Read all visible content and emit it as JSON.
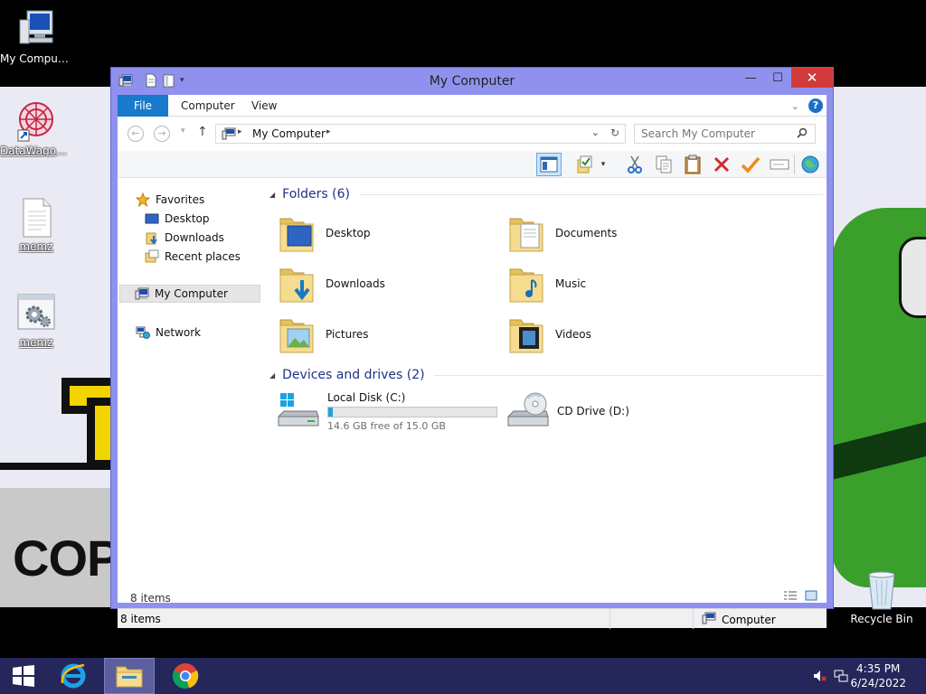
{
  "desktop": {
    "icons": [
      {
        "label": "My Computer"
      },
      {
        "label": "DataWagon..."
      },
      {
        "label": "memz"
      },
      {
        "label": "memz"
      },
      {
        "label": "Recycle Bin"
      }
    ],
    "wallpaper_text": "COP"
  },
  "window": {
    "title": "My Computer",
    "controls": {
      "minimize": "—",
      "maximize": "☐",
      "close": "✕"
    },
    "ribbon": {
      "tabs": [
        "File",
        "Computer",
        "View"
      ],
      "help": "?"
    },
    "address": {
      "path": "My Computer",
      "search_placeholder": "Search My Computer"
    },
    "nav_pane": {
      "favorites": "Favorites",
      "favorite_items": [
        "Desktop",
        "Downloads",
        "Recent places"
      ],
      "computer": "My Computer",
      "network": "Network"
    },
    "content": {
      "folders_header": "Folders (6)",
      "folders": [
        "Desktop",
        "Documents",
        "Downloads",
        "Music",
        "Pictures",
        "Videos"
      ],
      "devices_header": "Devices and drives (2)",
      "drives": [
        {
          "name": "Local Disk (C:)",
          "free_text": "14.6 GB free of 15.0 GB",
          "used_fraction": 0.027
        },
        {
          "name": "CD Drive (D:)"
        }
      ],
      "item_count": "8 items"
    },
    "statusbar": {
      "items": "8 items",
      "location": "Computer"
    }
  },
  "taskbar": {
    "time": "4:35 PM",
    "date": "6/24/2022"
  },
  "colors": {
    "window_frame": "#8e92ee",
    "ribbon_file_tab": "#1979ca",
    "group_header": "#1e3287",
    "taskbar": "#25275a",
    "close_button": "#d23a3a"
  }
}
